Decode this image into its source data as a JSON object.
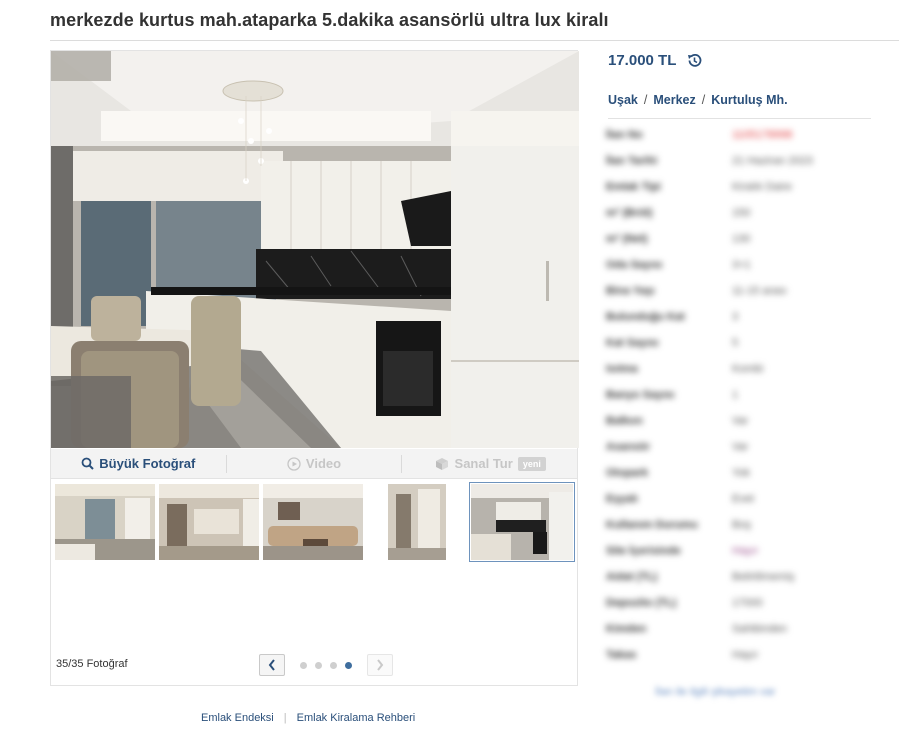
{
  "listing": {
    "title": "merkezde kurtus mah.ataparka 5.dakika asansörlü ultra lux kiralı"
  },
  "price": {
    "value": "17.000 TL",
    "history_icon": "history-icon"
  },
  "location": {
    "city": "Uşak",
    "district": "Merkez",
    "neighborhood": "Kurtuluş Mh."
  },
  "toolbar": {
    "big_photo": "Büyük Fotoğraf",
    "video": "Video",
    "virtual_tour": "Sanal Tur",
    "virtual_tour_badge": "yeni"
  },
  "gallery": {
    "photo_count": "35/35 Fotoğraf",
    "current_page": 4,
    "total_pages": 4
  },
  "info_rows": [
    {
      "k": "İlan No",
      "v": "1105178998"
    },
    {
      "k": "İlan Tarihi",
      "v": "21 Haziran 2023"
    },
    {
      "k": "Emlak Tipi",
      "v": "Kiralık Daire"
    },
    {
      "k": "m² (Brüt)",
      "v": "150"
    },
    {
      "k": "m² (Net)",
      "v": "130"
    },
    {
      "k": "Oda Sayısı",
      "v": "3+1"
    },
    {
      "k": "Bina Yaşı",
      "v": "11-15 arası"
    },
    {
      "k": "Bulunduğu Kat",
      "v": "3"
    },
    {
      "k": "Kat Sayısı",
      "v": "5"
    },
    {
      "k": "Isıtma",
      "v": "Kombi"
    },
    {
      "k": "Banyo Sayısı",
      "v": "1"
    },
    {
      "k": "Balkon",
      "v": "Var"
    },
    {
      "k": "Asansör",
      "v": "Var"
    },
    {
      "k": "Otopark",
      "v": "Yok"
    },
    {
      "k": "Eşyalı",
      "v": "Evet"
    },
    {
      "k": "Kullanım Durumu",
      "v": "Boş"
    },
    {
      "k": "Site İçerisinde",
      "v": "Hayır"
    },
    {
      "k": "Aidat (TL)",
      "v": "Belirtilmemiş"
    },
    {
      "k": "Depozito (TL)",
      "v": "17000"
    },
    {
      "k": "Kimden",
      "v": "Sahibinden"
    },
    {
      "k": "Takas",
      "v": "Hayır"
    }
  ],
  "report_link": "İlan ile ilgili şikayetim var",
  "footer": {
    "link1": "Emlak Endeksi",
    "link2": "Emlak Kiralama Rehberi"
  },
  "colors": {
    "accent": "#2a4f7a",
    "price": "#2a4f7a",
    "dot_active": "#3f6e9e"
  }
}
